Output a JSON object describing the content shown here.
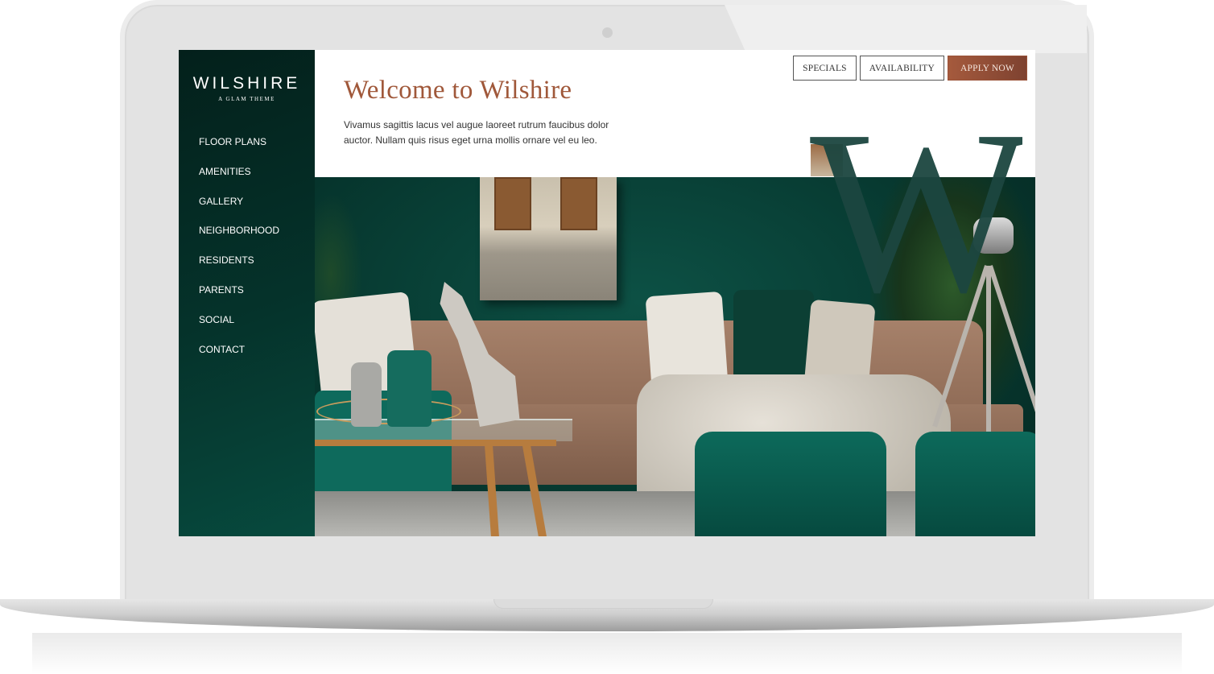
{
  "site": {
    "logo_title": "WILSHIRE",
    "logo_tagline": "A GLAM THEME"
  },
  "nav": {
    "items": [
      {
        "label": "FLOOR PLANS"
      },
      {
        "label": "AMENITIES"
      },
      {
        "label": "GALLERY"
      },
      {
        "label": "NEIGHBORHOOD"
      },
      {
        "label": "RESIDENTS"
      },
      {
        "label": "PARENTS"
      },
      {
        "label": "SOCIAL"
      },
      {
        "label": "CONTACT"
      }
    ]
  },
  "header": {
    "title": "Welcome to Wilshire",
    "intro": "Vivamus sagittis lacus vel augue laoreet rutrum faucibus dolor auctor. Nullam quis risus eget urna mollis ornare vel eu leo.",
    "buttons": {
      "specials": "SPECIALS",
      "availability": "AVAILABILITY",
      "apply": "APPLY NOW"
    }
  },
  "hero": {
    "monogram": "W",
    "image_alt": "Living room with emerald green wall, tan leather sofa, velvet ottomans and glass coffee table"
  },
  "colors": {
    "brand_green": "#05332b",
    "accent_copper": "#a0583a",
    "apply_button": "#a55a3d"
  }
}
